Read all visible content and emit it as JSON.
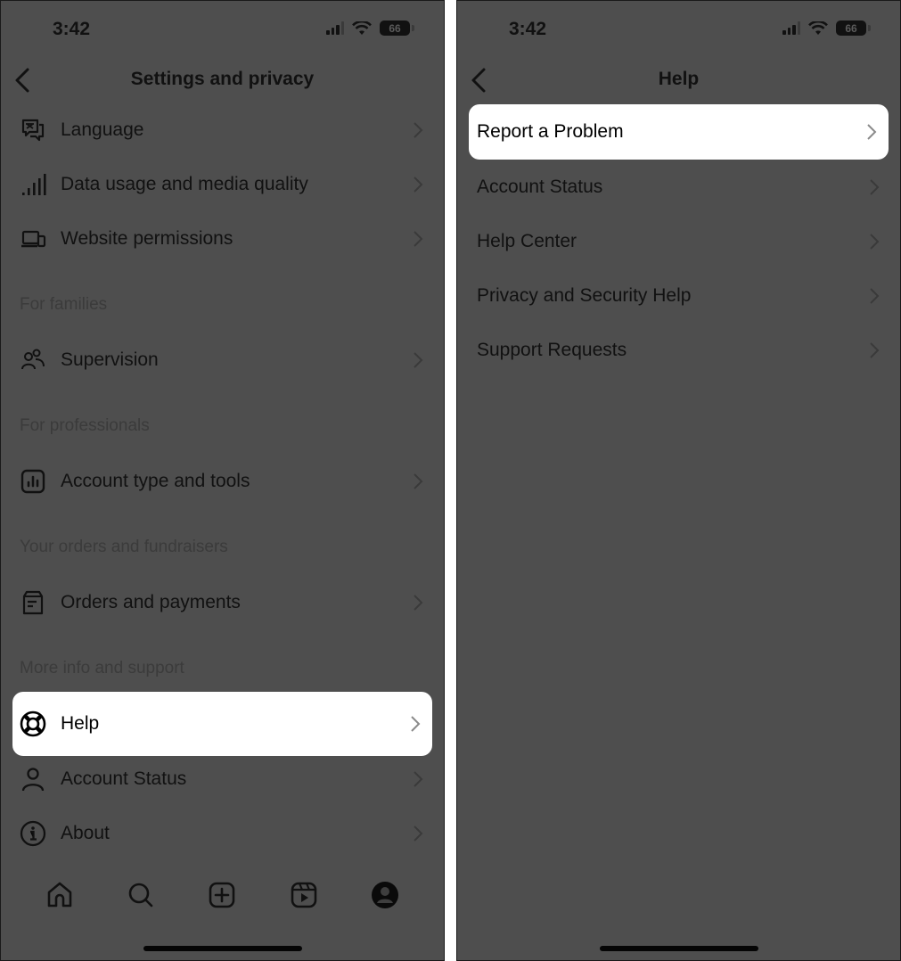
{
  "left_screen": {
    "status_bar": {
      "time": "3:42",
      "battery": "66"
    },
    "header": {
      "title": "Settings and privacy",
      "back_icon": "chevron-left-icon"
    },
    "rows": [
      {
        "label": "Language",
        "icon": "language-icon"
      },
      {
        "label": "Data usage and media quality",
        "icon": "signal-bars-icon"
      },
      {
        "label": "Website permissions",
        "icon": "devices-icon"
      },
      {
        "label": "Supervision",
        "icon": "people-icon"
      },
      {
        "label": "Account type and tools",
        "icon": "chart-box-icon"
      },
      {
        "label": "Orders and payments",
        "icon": "receipt-icon"
      },
      {
        "label": "Help",
        "icon": "lifebuoy-icon",
        "highlighted": true
      },
      {
        "label": "Account Status",
        "icon": "person-icon"
      },
      {
        "label": "About",
        "icon": "info-icon"
      }
    ],
    "sections": {
      "families": "For families",
      "professionals": "For professionals",
      "orders": "Your orders and fundraisers",
      "support": "More info and support"
    },
    "tab_bar": [
      {
        "name": "home",
        "icon": "home-icon"
      },
      {
        "name": "search",
        "icon": "search-icon"
      },
      {
        "name": "create",
        "icon": "plus-square-icon"
      },
      {
        "name": "reels",
        "icon": "reels-icon"
      },
      {
        "name": "profile",
        "icon": "profile-icon"
      }
    ]
  },
  "right_screen": {
    "status_bar": {
      "time": "3:42",
      "battery": "66"
    },
    "header": {
      "title": "Help",
      "back_icon": "chevron-left-icon"
    },
    "rows": [
      {
        "label": "Report a Problem",
        "highlighted": true
      },
      {
        "label": "Account Status"
      },
      {
        "label": "Help Center"
      },
      {
        "label": "Privacy and Security Help"
      },
      {
        "label": "Support Requests"
      }
    ]
  },
  "colors": {
    "overlay": "#4e4e4e",
    "highlight": "#ffffff",
    "text": "#111111",
    "section_header": "#3b3b3b"
  }
}
